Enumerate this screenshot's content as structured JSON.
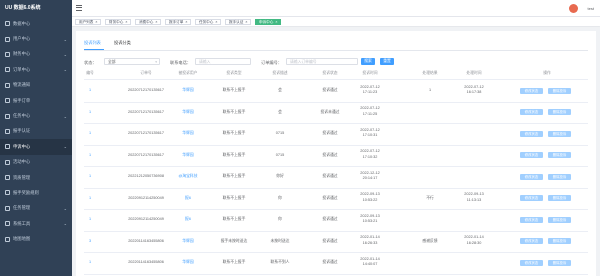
{
  "app": {
    "title": "UU 数据6.0系统"
  },
  "sidebar": {
    "items": [
      {
        "label": "数据中心",
        "icon": "dashboard-icon",
        "chevron": false
      },
      {
        "label": "用户中心",
        "icon": "user-icon",
        "chevron": true
      },
      {
        "label": "财务中心",
        "icon": "finance-icon",
        "chevron": true
      },
      {
        "label": "订单中心",
        "icon": "order-icon",
        "chevron": true
      },
      {
        "label": "物流通知",
        "icon": "notice-icon",
        "chevron": false
      },
      {
        "label": "报手订单",
        "icon": "document-icon",
        "chevron": false
      },
      {
        "label": "任务中心",
        "icon": "task-icon",
        "chevron": true
      },
      {
        "label": "报手认证",
        "icon": "verify-icon",
        "chevron": false
      },
      {
        "label": "申诉中心",
        "icon": "appeal-icon",
        "chevron": true
      },
      {
        "label": "活动中心",
        "icon": "activity-icon",
        "chevron": false
      },
      {
        "label": "资质管理",
        "icon": "badge-icon",
        "chevron": false
      },
      {
        "label": "报手奖励规则",
        "icon": "rule-icon",
        "chevron": false
      },
      {
        "label": "任务管理",
        "icon": "manage-icon",
        "chevron": true
      },
      {
        "label": "系统工具",
        "icon": "tools-icon",
        "chevron": true
      },
      {
        "label": "地图地图",
        "icon": "map-icon",
        "chevron": false
      }
    ],
    "active_index": 8
  },
  "topbar": {
    "username": "test"
  },
  "tags": [
    {
      "label": "用户列表",
      "active": false
    },
    {
      "label": "财务中心",
      "active": false
    },
    {
      "label": "消费中心",
      "active": false
    },
    {
      "label": "报手订单",
      "active": false
    },
    {
      "label": "任务中心",
      "active": false
    },
    {
      "label": "报手认证",
      "active": false
    },
    {
      "label": "申诉中心",
      "active": true
    }
  ],
  "subtabs": [
    {
      "label": "投诉列表",
      "active": true
    },
    {
      "label": "投诉分类",
      "active": false
    }
  ],
  "filters": {
    "status_label": "状态：",
    "status_value": "全部",
    "phone_label": "联系电话：",
    "phone_placeholder": "请输入",
    "order_label": "订单编号：",
    "order_placeholder": "请输入订单编号",
    "search_label": "搜索",
    "reset_label": "重置"
  },
  "table": {
    "columns": [
      "编号",
      "订单号",
      "被投诉用户",
      "投诉类型",
      "投诉描述",
      "投诉状态",
      "投诉时间",
      "处理结果",
      "处理时间",
      "操作"
    ],
    "rows": [
      {
        "id": "1",
        "order": "20220712170135617",
        "user": "华辉园",
        "type": "联系不上报手",
        "desc": "会",
        "status": "投诉通过",
        "time1": "2022-07-12",
        "time2": "17:11:23",
        "result": "1",
        "ptime1": "2022-07-12",
        "ptime2": "16:17:38"
      },
      {
        "id": "1",
        "order": "20220712170135617",
        "user": "华辉园",
        "type": "联系不上报手",
        "desc": "会",
        "status": "投诉未通过",
        "time1": "2022-07-12",
        "time2": "17:11:25",
        "result": "",
        "ptime1": "",
        "ptime2": ""
      },
      {
        "id": "1",
        "order": "20220712170135617",
        "user": "华辉园",
        "type": "联系不上报手",
        "desc": "0715",
        "status": "投诉通过",
        "time1": "2022-07-12",
        "time2": "17:10:31",
        "result": "",
        "ptime1": "",
        "ptime2": ""
      },
      {
        "id": "1",
        "order": "20220712170135617",
        "user": "华辉园",
        "type": "联系不上报手",
        "desc": "0715",
        "status": "投诉通过",
        "time1": "2022-07-12",
        "time2": "17:10:32",
        "result": "",
        "ptime1": "",
        "ptime2": ""
      },
      {
        "id": "1",
        "order": "20221212050736908",
        "user": "@淘宝科技",
        "type": "联系不上报手",
        "desc": "你好",
        "status": "投诉通过",
        "time1": "2022-12-12",
        "time2": "20:14:17",
        "result": "",
        "ptime1": "",
        "ptime2": ""
      },
      {
        "id": "1",
        "order": "20220912114250049",
        "user": "报6",
        "type": "联系不上报手",
        "desc": "你",
        "status": "投诉通过",
        "time1": "2022-09-13",
        "time2": "10:53:22",
        "result": "不行",
        "ptime1": "2022-09-13",
        "ptime2": "11:13:13"
      },
      {
        "id": "1",
        "order": "20220912114250049",
        "user": "报6",
        "type": "联系不上报手",
        "desc": "你",
        "status": "投诉通过",
        "time1": "2022-09-13",
        "time2": "10:53:21",
        "result": "",
        "ptime1": "",
        "ptime2": ""
      },
      {
        "id": "3",
        "order": "20220114163455806",
        "user": "华辉园",
        "type": "报手未按时送达",
        "desc": "未按时送达",
        "status": "投诉通过",
        "time1": "2022-01-14",
        "time2": "16:26:33",
        "result": "感谢反馈",
        "ptime1": "2022-01-14",
        "ptime2": "16:28:30"
      },
      {
        "id": "1",
        "order": "20220114163455806",
        "user": "华辉园",
        "type": "联系不上报手",
        "desc": "联系不到人",
        "status": "投诉通过",
        "time1": "2022-01-14",
        "time2": "14:40:07",
        "result": "",
        "ptime1": "",
        "ptime2": ""
      }
    ],
    "op_edit": "修改状态",
    "op_delete": "删除投诉"
  },
  "colors": {
    "sidebar": "#304156",
    "primary": "#409eff",
    "active_tag": "#42b983"
  }
}
